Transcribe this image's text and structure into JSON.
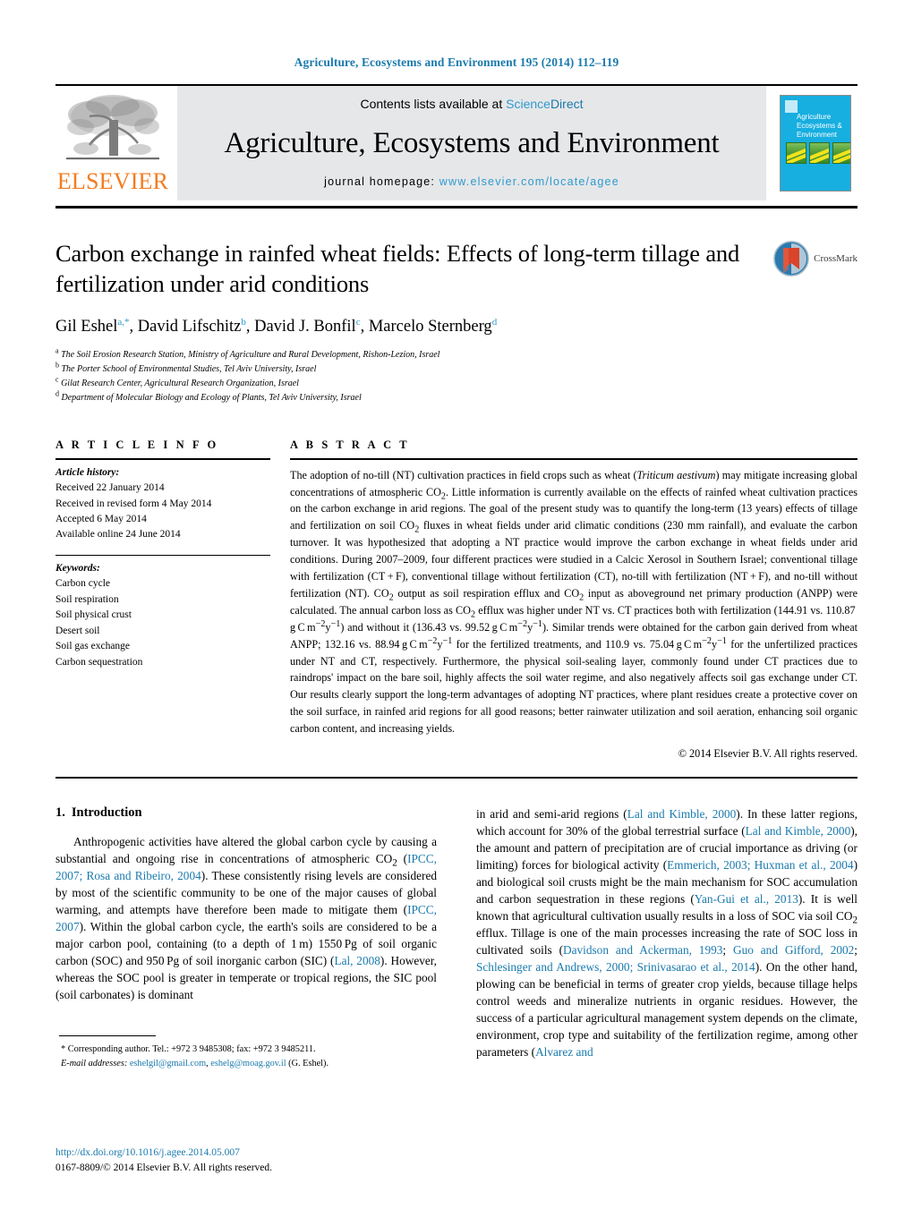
{
  "running_head": "Agriculture, Ecosystems and Environment 195 (2014) 112–119",
  "masthead": {
    "publisher_logo_text": "ELSEVIER",
    "contents_prefix": "Contents lists available at ",
    "contents_link_part1": "Science",
    "contents_link_part2": "Direct",
    "journal_name": "Agriculture, Ecosystems and Environment",
    "homepage_label": "journal homepage:",
    "homepage_url": "www.elsevier.com/locate/agee",
    "cover_title": "Agriculture Ecosystems & Environment"
  },
  "article": {
    "title": "Carbon exchange in rainfed wheat fields: Effects of long-term tillage and fertilization under arid conditions",
    "crossmark_label": "CrossMark",
    "authors": [
      {
        "name": "Gil Eshel",
        "marks": "a,*"
      },
      {
        "name": "David Lifschitz",
        "marks": "b"
      },
      {
        "name": "David J. Bonfil",
        "marks": "c"
      },
      {
        "name": "Marcelo Sternberg",
        "marks": "d"
      }
    ],
    "affiliations": [
      {
        "mark": "a",
        "text": "The Soil Erosion Research Station, Ministry of Agriculture and Rural Development, Rishon-Lezion, Israel"
      },
      {
        "mark": "b",
        "text": "The Porter School of Environmental Studies, Tel Aviv University, Israel"
      },
      {
        "mark": "c",
        "text": "Gilat Research Center, Agricultural Research Organization, Israel"
      },
      {
        "mark": "d",
        "text": "Department of Molecular Biology and Ecology of Plants, Tel Aviv University, Israel"
      }
    ]
  },
  "article_info": {
    "heading": "A R T I C L E   I N F O",
    "history_label": "Article history:",
    "history": [
      "Received 22 January 2014",
      "Received in revised form 4 May 2014",
      "Accepted 6 May 2014",
      "Available online 24 June 2014"
    ],
    "keywords_label": "Keywords:",
    "keywords": [
      "Carbon cycle",
      "Soil respiration",
      "Soil physical crust",
      "Desert soil",
      "Soil gas exchange",
      "Carbon sequestration"
    ]
  },
  "abstract": {
    "heading": "A B S T R A C T",
    "copyright": "© 2014 Elsevier B.V. All rights reserved."
  },
  "introduction": {
    "number": "1.",
    "heading": "Introduction"
  },
  "footnote": {
    "corresponding": "* Corresponding author. Tel.: +972 3 9485308; fax: +972 3 9485211.",
    "email_label": "E-mail addresses:",
    "email1": "eshelgil@gmail.com",
    "email2": "eshelg@moag.gov.il",
    "email_suffix": "(G. Eshel)."
  },
  "page_footer": {
    "doi": "http://dx.doi.org/10.1016/j.agee.2014.05.007",
    "issn_line": "0167-8809/© 2014 Elsevier B.V. All rights reserved."
  },
  "colors": {
    "link": "#1a7aad",
    "science_direct": "#2e9ad0",
    "elsevier_orange": "#f47c20",
    "cover_blue": "#17aee0",
    "masthead_grey": "#e6e7e8"
  }
}
